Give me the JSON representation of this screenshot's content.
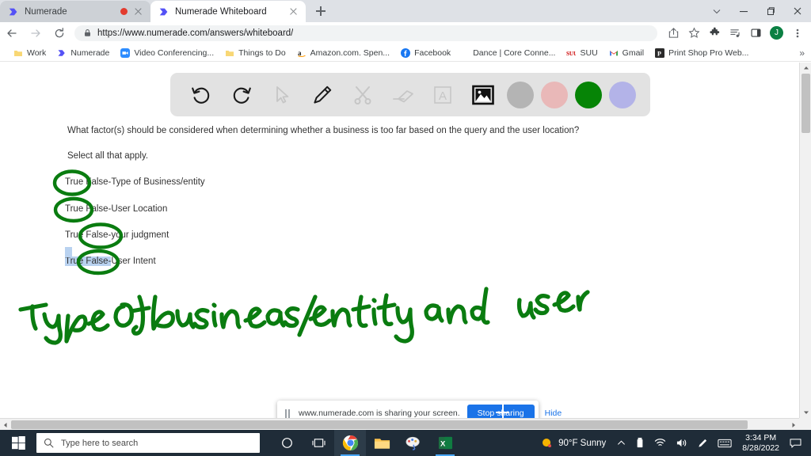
{
  "browser": {
    "tabs": [
      {
        "title": "Numerade",
        "active": false,
        "recording": true
      },
      {
        "title": "Numerade Whiteboard",
        "active": true,
        "recording": false
      }
    ],
    "new_tab_label": "+",
    "window_controls": [
      "tab-search",
      "minimize",
      "maximize",
      "close"
    ],
    "address": {
      "url": "https://www.numerade.com/answers/whiteboard/",
      "security_icon": "lock-icon"
    },
    "profile_initial": "J",
    "bookmarks": [
      {
        "label": "Work",
        "icon": "folder-icon"
      },
      {
        "label": "Numerade",
        "icon": "numerade-icon"
      },
      {
        "label": "Video Conferencing...",
        "icon": "zoom-icon"
      },
      {
        "label": "Things to Do",
        "icon": "folder-icon"
      },
      {
        "label": "Amazon.com. Spen...",
        "icon": "amazon-icon"
      },
      {
        "label": "Facebook",
        "icon": "facebook-icon"
      },
      {
        "label": "Dance | Core Conne...",
        "icon": "none"
      },
      {
        "label": "SUU",
        "icon": "suu-icon"
      },
      {
        "label": "Gmail",
        "icon": "gmail-icon"
      },
      {
        "label": "Print Shop Pro Web...",
        "icon": "printshop-icon"
      }
    ],
    "bookmarks_overflow": "»"
  },
  "whiteboard": {
    "tools": [
      {
        "name": "undo",
        "state": "enabled"
      },
      {
        "name": "redo",
        "state": "enabled"
      },
      {
        "name": "select-cursor",
        "state": "disabled"
      },
      {
        "name": "pencil",
        "state": "enabled"
      },
      {
        "name": "scissors",
        "state": "disabled"
      },
      {
        "name": "eraser",
        "state": "disabled"
      },
      {
        "name": "text",
        "state": "disabled"
      },
      {
        "name": "image",
        "state": "active"
      }
    ],
    "colors": [
      {
        "name": "gray",
        "hex": "#b4b4b4",
        "selected": false
      },
      {
        "name": "pink",
        "hex": "#e9b8b8",
        "selected": false
      },
      {
        "name": "green",
        "hex": "#068406",
        "selected": true
      },
      {
        "name": "purple",
        "hex": "#b3b3e8",
        "selected": false
      }
    ],
    "ink_color": "#0a7c10",
    "handwriting": "Type of business/entity and user"
  },
  "question": {
    "prompt": "What factor(s) should be considered when determining whether a business is too far based on the query and the user location?",
    "instruction": "Select all that apply.",
    "options": [
      {
        "pre": "True",
        "mid": " False-",
        "post": "Type of Business/entity",
        "circled": "True",
        "highlighted": false
      },
      {
        "pre": "True",
        "mid": " False-",
        "post": "User Location",
        "circled": "True",
        "highlighted": false
      },
      {
        "pre": "True",
        "mid": " False-",
        "post": "your judgment",
        "circled": "False",
        "highlighted": false
      },
      {
        "pre": "True",
        "mid": " False-",
        "post": "User Intent",
        "circled": "False",
        "highlighted": true
      }
    ]
  },
  "share_bar": {
    "message": "www.numerade.com is sharing your screen.",
    "stop_label": "Stop sharing",
    "hide_label": "Hide",
    "pause_icon": "pause-icon"
  },
  "taskbar": {
    "search_placeholder": "Type here to search",
    "apps": [
      {
        "name": "cortana",
        "label": "Cortana"
      },
      {
        "name": "task-view",
        "label": "Task View"
      },
      {
        "name": "chrome",
        "label": "Google Chrome",
        "active": true
      },
      {
        "name": "file-explorer",
        "label": "File Explorer",
        "active": false
      },
      {
        "name": "paint",
        "label": "Paint",
        "active": false
      },
      {
        "name": "excel",
        "label": "Excel",
        "active": true
      }
    ],
    "weather": "90°F  Sunny",
    "time": "3:34 PM",
    "date": "8/28/2022",
    "tray_icons": [
      "chevron-up-icon",
      "battery-icon",
      "wifi-icon",
      "volume-icon",
      "pen-icon",
      "keyboard-icon",
      "notification-icon"
    ]
  }
}
